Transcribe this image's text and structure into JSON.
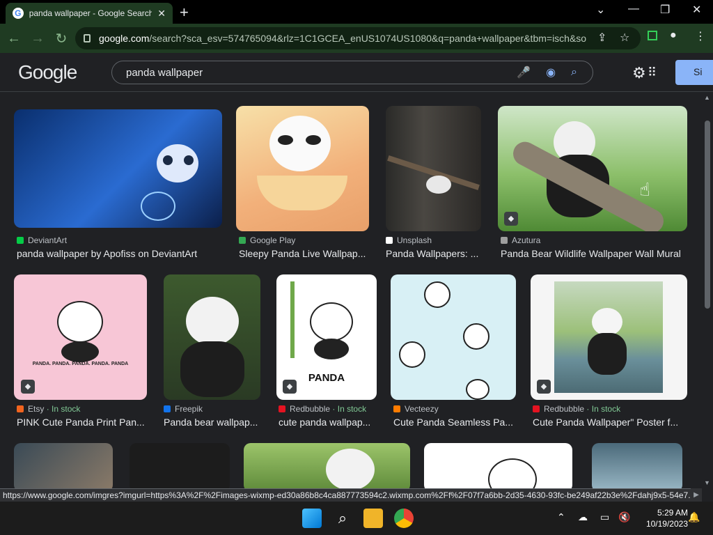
{
  "browser": {
    "tab_title": "panda wallpaper - Google Search",
    "tab_close": "✕",
    "new_tab": "+",
    "url_host": "google.com",
    "url_path": "/search?sca_esv=574765094&rlz=1C1GCEA_enUS1074US1080&q=panda+wallpaper&tbm=isch&so...",
    "window_controls": [
      "⌄",
      "—",
      "❐",
      "✕"
    ]
  },
  "google": {
    "logo": "Google",
    "query": "panda wallpaper",
    "signin": "Si"
  },
  "row1": [
    {
      "source": "DeviantArt",
      "stock": "",
      "caption": "panda wallpaper by Apofiss on DeviantArt",
      "src_color": "#05cc47"
    },
    {
      "source": "Google Play",
      "stock": "",
      "caption": "Sleepy Panda Live Wallpap...",
      "src_color": "#34a853"
    },
    {
      "source": "Unsplash",
      "stock": "",
      "caption": "Panda Wallpapers: ...",
      "src_color": "#ffffff"
    },
    {
      "source": "Azutura",
      "stock": "",
      "caption": "Panda Bear Wildlife Wallpaper Wall Mural",
      "src_color": "#9e9e9e"
    }
  ],
  "row2": [
    {
      "source": "Etsy",
      "stock": "· In stock",
      "caption": "PINK Cute Panda Print Pan...",
      "src_color": "#f1641e"
    },
    {
      "source": "Freepik",
      "stock": "",
      "caption": "Panda bear wallpap...",
      "src_color": "#1273eb"
    },
    {
      "source": "Redbubble",
      "stock": "· In stock",
      "caption": "cute panda wallpap...",
      "src_color": "#e41321"
    },
    {
      "source": "Vecteezy",
      "stock": "",
      "caption": "Cute Panda Seamless Pa...",
      "src_color": "#ff7c00"
    },
    {
      "source": "Redbubble",
      "stock": "· In stock",
      "caption": "Cute Panda Wallpaper\" Poster f...",
      "src_color": "#e41321"
    }
  ],
  "image_text": {
    "panda_label": "PANDA",
    "pink_text": "PANDA. PANDA. PANDA. PANDA. PANDA"
  },
  "status_url": "https://www.google.com/imgres?imgurl=https%3A%2F%2Fimages-wixmp-ed30a86b8c4ca887773594c2.wixmp.com%2Ff%2F07f7a6bb-2d35-4630-93fc-be249af22b3e%2Fdahj9x5-54e7...",
  "taskbar": {
    "time": "5:29 AM",
    "date": "10/19/2023"
  }
}
